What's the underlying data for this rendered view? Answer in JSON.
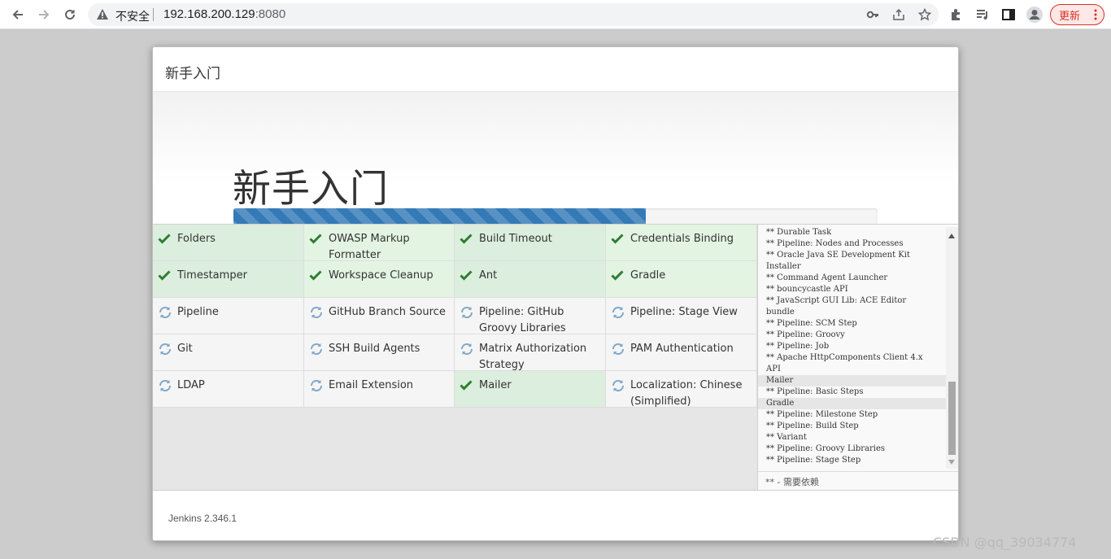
{
  "browser": {
    "insecure_label": "不安全",
    "url_host": "192.168.200.129",
    "url_port": ":8080",
    "update_label": "更新"
  },
  "dialog": {
    "header_title": "新手入门",
    "hero_title": "新手入门",
    "progress_percent": 64
  },
  "plugins": [
    {
      "label": "Folders",
      "status": "installed"
    },
    {
      "label": "OWASP Markup Formatter",
      "status": "installed"
    },
    {
      "label": "Build Timeout",
      "status": "installed"
    },
    {
      "label": "Credentials Binding",
      "status": "installed"
    },
    {
      "label": "Timestamper",
      "status": "installed"
    },
    {
      "label": "Workspace Cleanup",
      "status": "installed"
    },
    {
      "label": "Ant",
      "status": "installed"
    },
    {
      "label": "Gradle",
      "status": "installed"
    },
    {
      "label": "Pipeline",
      "status": "pending"
    },
    {
      "label": "GitHub Branch Source",
      "status": "pending"
    },
    {
      "label": "Pipeline: GitHub Groovy Libraries",
      "status": "pending"
    },
    {
      "label": "Pipeline: Stage View",
      "status": "pending"
    },
    {
      "label": "Git",
      "status": "pending"
    },
    {
      "label": "SSH Build Agents",
      "status": "pending"
    },
    {
      "label": "Matrix Authorization Strategy",
      "status": "pending"
    },
    {
      "label": "PAM Authentication",
      "status": "pending"
    },
    {
      "label": "LDAP",
      "status": "pending"
    },
    {
      "label": "Email Extension",
      "status": "pending"
    },
    {
      "label": "Mailer",
      "status": "installed"
    },
    {
      "label": "Localization: Chinese (Simplified)",
      "status": "pending"
    }
  ],
  "log": {
    "lines": [
      {
        "text": "** Durable Task",
        "highlight": false
      },
      {
        "text": "** Pipeline: Nodes and Processes",
        "highlight": false
      },
      {
        "text": "** Oracle Java SE Development Kit",
        "highlight": false
      },
      {
        "text": "Installer",
        "highlight": false
      },
      {
        "text": "** Command Agent Launcher",
        "highlight": false
      },
      {
        "text": "** bouncycastle API",
        "highlight": false
      },
      {
        "text": "** JavaScript GUI Lib: ACE Editor",
        "highlight": false
      },
      {
        "text": "bundle",
        "highlight": false
      },
      {
        "text": "** Pipeline: SCM Step",
        "highlight": false
      },
      {
        "text": "** Pipeline: Groovy",
        "highlight": false
      },
      {
        "text": "** Pipeline: Job",
        "highlight": false
      },
      {
        "text": "** Apache HttpComponents Client 4.x",
        "highlight": false
      },
      {
        "text": "API",
        "highlight": false
      },
      {
        "text": "Mailer",
        "highlight": true
      },
      {
        "text": "** Pipeline: Basic Steps",
        "highlight": false
      },
      {
        "text": "Gradle",
        "highlight": true
      },
      {
        "text": "** Pipeline: Milestone Step",
        "highlight": false
      },
      {
        "text": "** Pipeline: Build Step",
        "highlight": false
      },
      {
        "text": "** Variant",
        "highlight": false
      },
      {
        "text": "** Pipeline: Groovy Libraries",
        "highlight": false
      },
      {
        "text": "** Pipeline: Stage Step",
        "highlight": false
      }
    ],
    "footer": "** - 需要依赖"
  },
  "footer": {
    "version": "Jenkins 2.346.1"
  },
  "watermark": "CSDN @qq_39034774",
  "colors": {
    "progress": "#337ab7",
    "installed_bg": "#dceedd",
    "check": "#2e7d32",
    "pending_icon": "#7fa7c9"
  }
}
